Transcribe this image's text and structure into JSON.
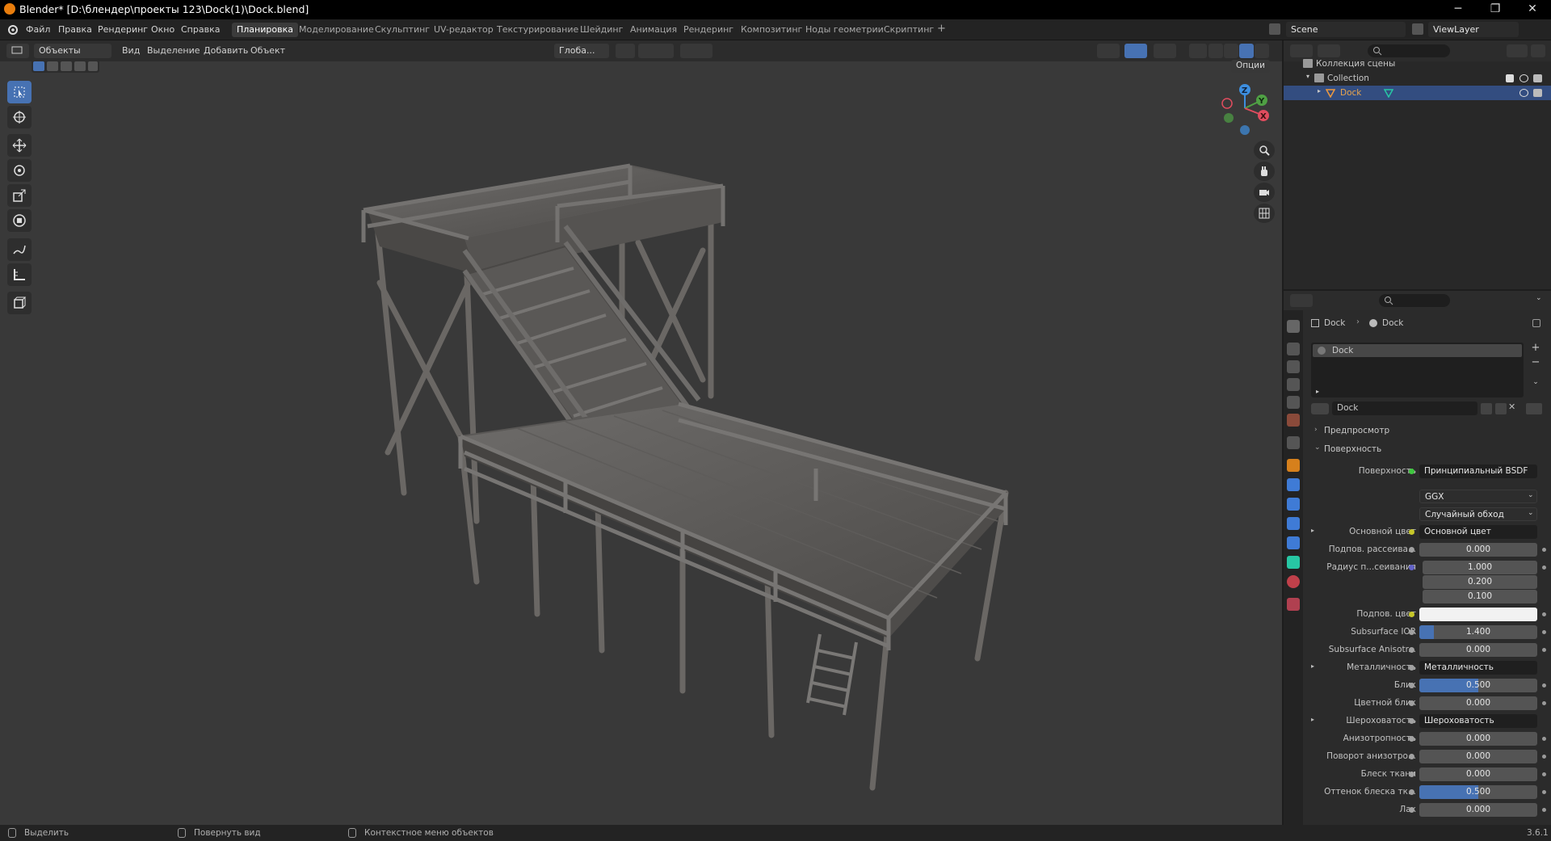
{
  "window": {
    "title": "Blender* [D:\\блендер\\проекты 123\\Dock(1)\\Dock.blend]",
    "minimize": "─",
    "maximize": "❐",
    "close": "✕"
  },
  "menu": [
    "Файл",
    "Правка",
    "Рендеринг",
    "Окно",
    "Справка"
  ],
  "workspaces": {
    "tabs": [
      "Планировка",
      "Моделирование",
      "Скульптинг",
      "UV-редактор",
      "Текстурирование",
      "Шейдинг",
      "Анимация",
      "Рендеринг",
      "Композитинг",
      "Ноды геометрии",
      "Скриптинг"
    ],
    "add": "+"
  },
  "scene": {
    "name": "Scene",
    "view_layer": "ViewLayer"
  },
  "viewport_header": {
    "mode": "Объекты",
    "menus": [
      "Вид",
      "Выделение",
      "Добавить",
      "Объект"
    ],
    "transform": "Глоба...",
    "options": "Опции"
  },
  "gizmo": {
    "x": "X",
    "y": "Y",
    "z": "Z"
  },
  "outliner": {
    "scene_collection": "Коллекция сцены",
    "collection": "Collection",
    "object": "Dock"
  },
  "properties": {
    "breadcrumb_object": "Dock",
    "breadcrumb_material": "Dock",
    "slot": "Dock",
    "material_name": "Dock",
    "panel_preview": "Предпросмотр",
    "panel_surface": "Поверхность",
    "rows": [
      {
        "label": "Поверхность",
        "value": "Принципиальный BSDF",
        "type": "link",
        "dot": "green"
      },
      {
        "label": "",
        "value": "GGX",
        "type": "dropdown"
      },
      {
        "label": "",
        "value": "Случайный обход",
        "type": "dropdown"
      },
      {
        "label": "Основной цвет",
        "value": "Основной цвет",
        "type": "link",
        "dot": "yellow",
        "expand": true
      },
      {
        "label": "Подпов. рассеива...",
        "value": "0.000",
        "type": "number",
        "dot": "gray"
      },
      {
        "label": "Радиус п...сеивания",
        "value": "1.000",
        "type": "number",
        "dot": "blue"
      },
      {
        "label": "",
        "value": "0.200",
        "type": "number"
      },
      {
        "label": "",
        "value": "0.100",
        "type": "number"
      },
      {
        "label": "Подпов. цвет",
        "value": "",
        "type": "color",
        "dot": "yellow"
      },
      {
        "label": "Subsurface IOR",
        "value": "1.400",
        "type": "slider",
        "fraction": 0.12,
        "dot": "gray"
      },
      {
        "label": "Subsurface Anisotr...",
        "value": "0.000",
        "type": "number",
        "dot": "gray"
      },
      {
        "label": "Металличность",
        "value": "Металличность",
        "type": "link",
        "dot": "gray",
        "expand": true
      },
      {
        "label": "Блик",
        "value": "0.500",
        "type": "slider",
        "fraction": 0.5,
        "dot": "gray"
      },
      {
        "label": "Цветной блик",
        "value": "0.000",
        "type": "number",
        "dot": "gray"
      },
      {
        "label": "Шероховатость",
        "value": "Шероховатость",
        "type": "link",
        "dot": "gray",
        "expand": true
      },
      {
        "label": "Анизотропность",
        "value": "0.000",
        "type": "number",
        "dot": "gray"
      },
      {
        "label": "Поворот анизотро...",
        "value": "0.000",
        "type": "number",
        "dot": "gray"
      },
      {
        "label": "Блеск ткани",
        "value": "0.000",
        "type": "number",
        "dot": "gray"
      },
      {
        "label": "Оттенок блеска тк...",
        "value": "0.500",
        "type": "slider",
        "fraction": 0.5,
        "dot": "gray"
      },
      {
        "label": "Лак",
        "value": "0.000",
        "type": "number",
        "dot": "gray"
      }
    ]
  },
  "statusbar": {
    "select": "Выделить",
    "rotate": "Повернуть вид",
    "context": "Контекстное меню объектов",
    "version": "3.6.1"
  }
}
